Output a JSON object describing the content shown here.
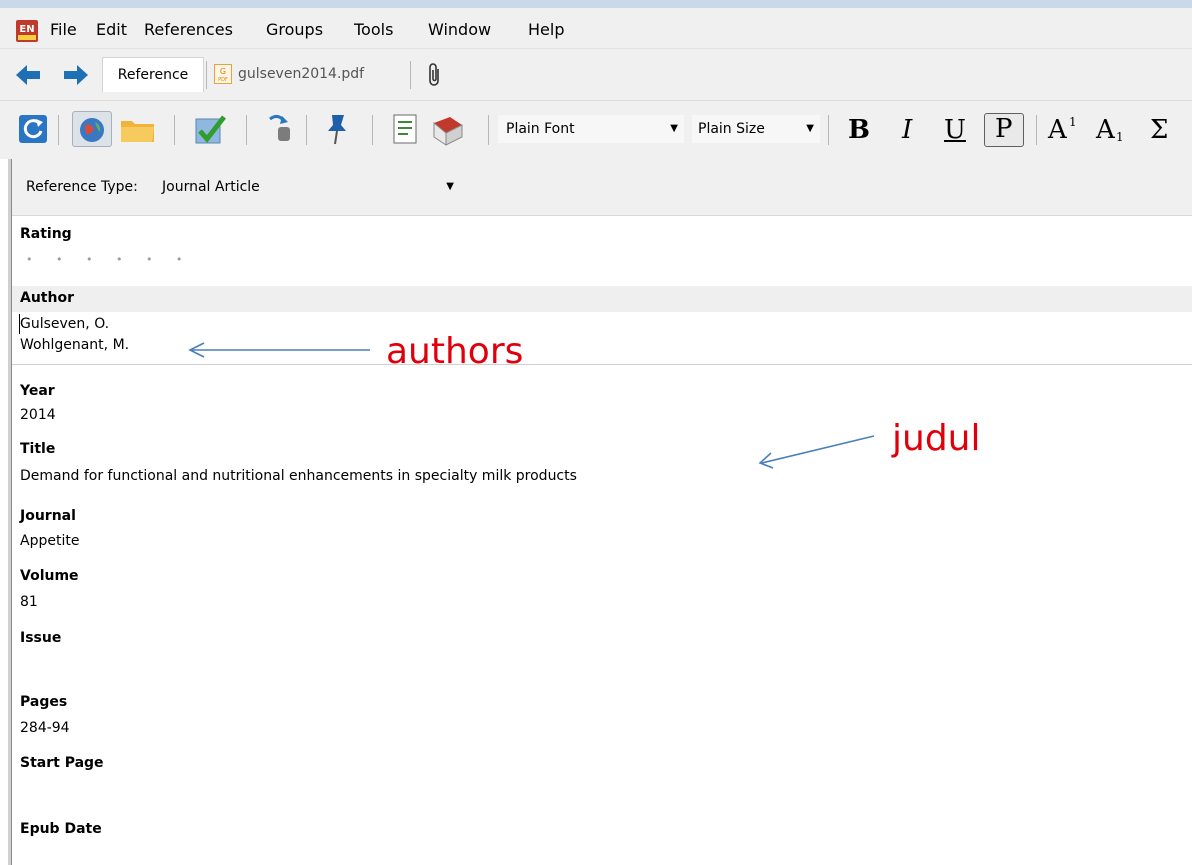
{
  "menu": {
    "app_icon_text": "EN",
    "items": [
      "File",
      "Edit",
      "References",
      "Groups",
      "Tools",
      "Window",
      "Help"
    ]
  },
  "tabs": {
    "reference": "Reference",
    "pdf": "gulseven2014.pdf"
  },
  "toolbar": {
    "font_combo": "Plain Font",
    "size_combo": "Plain Size",
    "bold": "B",
    "italic": "I",
    "underline": "U",
    "plain": "P",
    "superscript": "A",
    "superscript_mark": "1",
    "subscript": "A",
    "subscript_mark": "1",
    "symbol": "Σ"
  },
  "reference_type": {
    "label": "Reference Type:",
    "value": "Journal Article"
  },
  "fields": {
    "rating": {
      "label": "Rating",
      "value": "• • • • • •"
    },
    "author": {
      "label": "Author",
      "values": [
        "Gulseven, O.",
        "Wohlgenant, M."
      ]
    },
    "year": {
      "label": "Year",
      "value": "2014"
    },
    "title": {
      "label": "Title",
      "value": "Demand for functional and nutritional enhancements in specialty milk products"
    },
    "journal": {
      "label": "Journal",
      "value": "Appetite"
    },
    "volume": {
      "label": "Volume",
      "value": "81"
    },
    "issue": {
      "label": "Issue",
      "value": ""
    },
    "pages": {
      "label": "Pages",
      "value": "284-94"
    },
    "start_page": {
      "label": "Start Page",
      "value": ""
    },
    "epub_date": {
      "label": "Epub Date",
      "value": ""
    }
  },
  "annotations": {
    "authors": "authors",
    "judul": "judul",
    "color": "#e0000b",
    "arrow_color": "#4a7ebb"
  }
}
